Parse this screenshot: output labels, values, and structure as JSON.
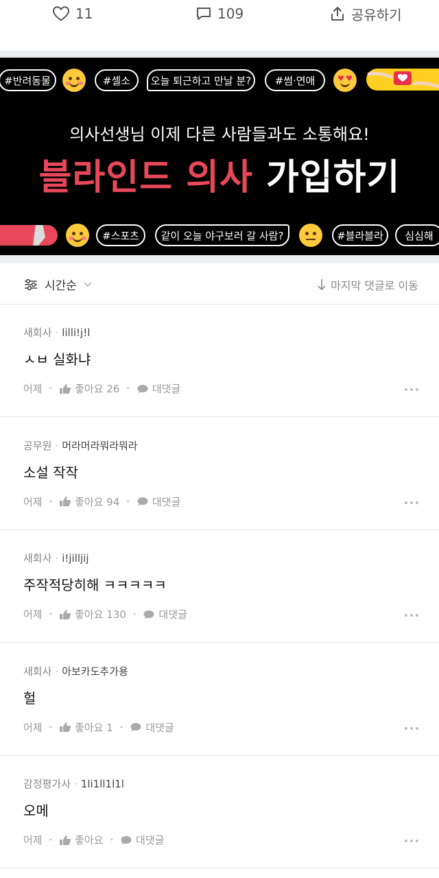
{
  "actions": {
    "like_count": "11",
    "comment_count": "109",
    "share_label": "공유하기"
  },
  "banner": {
    "tags": {
      "pets": "#반려동물",
      "selfie": "#셀소",
      "after_work": "오늘 퇴근하고 만날 분?",
      "romance": "#썸·연애",
      "sports": "#스포츠",
      "baseball": "같이 오늘 야구보러 갈 사람?",
      "blabla": "#블라블라",
      "bored": "심심해"
    },
    "subtitle": "의사선생님 이제 다른 사람들과도 소통해요!",
    "title_red": "블라인드 의사",
    "title_white": "가입하기"
  },
  "sort": {
    "label": "시간순",
    "jump_label": "마지막 댓글로 이동"
  },
  "comments": [
    {
      "company": "새회사",
      "nickname": "lilli!j!l",
      "text": "ㅅㅂ 실화냐",
      "date": "어제",
      "likes": "좋아요 26",
      "reply": "대댓글"
    },
    {
      "company": "공무원",
      "nickname": "머라머라뭐라뭐라",
      "text": "소설 작작",
      "date": "어제",
      "likes": "좋아요 94",
      "reply": "대댓글"
    },
    {
      "company": "새회사",
      "nickname": "i!jilljij",
      "text": "주작적당히해 ㅋㅋㅋㅋㅋ",
      "date": "어제",
      "likes": "좋아요 130",
      "reply": "대댓글"
    },
    {
      "company": "새회사",
      "nickname": "아보카도추가용",
      "text": "헐",
      "date": "어제",
      "likes": "좋아요 1",
      "reply": "대댓글"
    },
    {
      "company": "감정평가사",
      "nickname": "1li1ll1l1l",
      "text": "오메",
      "date": "어제",
      "likes": "좋아요",
      "reply": "대댓글"
    }
  ],
  "colors": {
    "brand_red": "#e8485a",
    "banner_bg": "#000000",
    "emoji_yellow": "#ffc93c"
  },
  "icons": [
    "heart-icon",
    "speech-bubble-icon",
    "share-icon",
    "sliders-icon",
    "chevron-down-icon",
    "arrow-down-icon",
    "thumbs-up-icon",
    "chat-bubble-icon",
    "more-icon"
  ]
}
